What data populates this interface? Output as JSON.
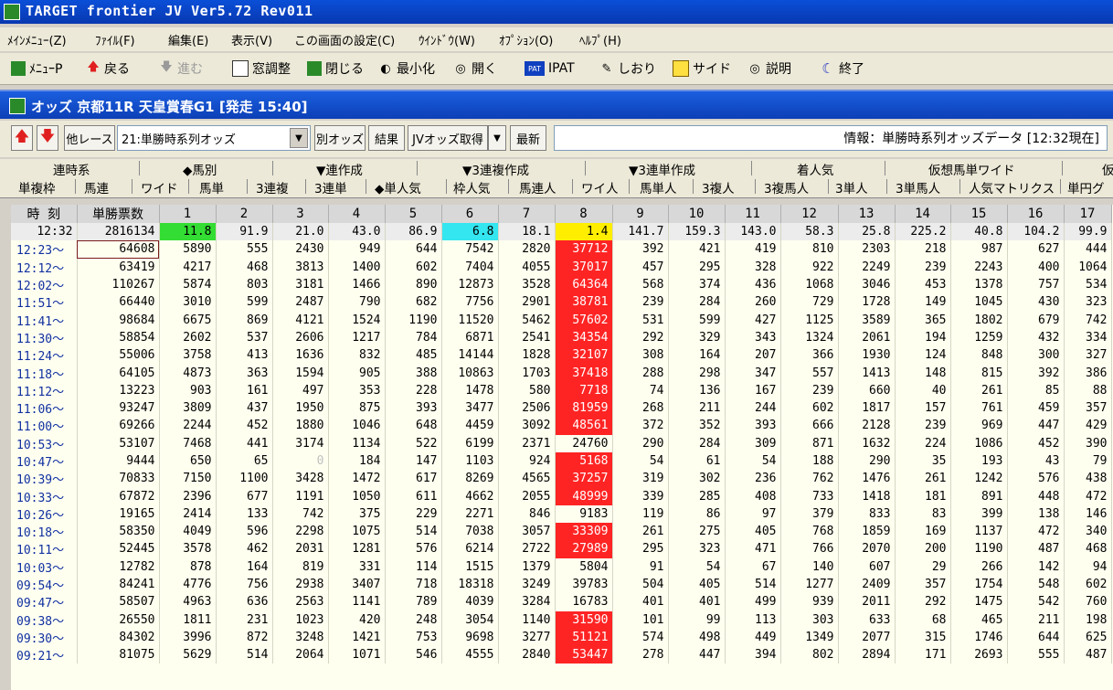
{
  "window": {
    "title": "TARGET frontier JV  Ver5.72  Rev011"
  },
  "menu": [
    "ﾒｲﾝﾒﾆｭｰ(Z)",
    "ﾌｧｲﾙ(F)",
    "編集(E)",
    "表示(V)",
    "この画面の設定(C)",
    "ｳｲﾝﾄﾞｳ(W)",
    "ｵﾌﾟｼｮﾝ(O)",
    "ﾍﾙﾌﾟ(H)"
  ],
  "toolbar": {
    "menu_p": "ﾒﾆｭｰP",
    "back": "戻る",
    "forward": "進む",
    "window_adjust": "窓調整",
    "close": "閉じる",
    "minimize": "最小化",
    "open": "開く",
    "ipat": "IPAT",
    "bookmark": "しおり",
    "side": "サイド",
    "help": "説明",
    "exit": "終了"
  },
  "subwindow": {
    "title": "オッズ 京都11R 天皇賞春G1  [発走 15:40]"
  },
  "controls": {
    "other_race": "他レース",
    "combo_value": "21:単勝時系列オッズ",
    "other_odds": "別オッズ",
    "result": "結果",
    "jv_odds": "JVオッズ取得",
    "dropdown_glyph": "▼",
    "refresh": "最新",
    "info": "情報：単勝時系列オッズデータ [12:32現在]"
  },
  "tabs_row1": [
    "連時系",
    "◆馬別",
    "▼連作成",
    "▼3連複作成",
    "▼3連単作成",
    "着人気",
    "仮想馬単ワイド",
    "仮"
  ],
  "tabs_row2": [
    "単複枠",
    "馬連",
    "ワイド",
    "馬単",
    "3連複",
    "3連単",
    "◆単人気",
    "枠人気",
    "馬連人",
    "ワイ人",
    "馬単人",
    "3複人",
    "3複馬人",
    "3単人",
    "3単馬人",
    "人気マトリクス",
    "単円グ"
  ],
  "table": {
    "headers": [
      "時 刻",
      "単勝票数",
      "1",
      "2",
      "3",
      "4",
      "5",
      "6",
      "7",
      "8",
      "9",
      "10",
      "11",
      "12",
      "13",
      "14",
      "15",
      "16",
      "17"
    ],
    "odds_row": [
      "12:32",
      "2816134",
      "11.8",
      "91.9",
      "21.0",
      "43.0",
      "86.9",
      "6.8",
      "18.1",
      "1.4",
      "141.7",
      "159.3",
      "143.0",
      "58.3",
      "25.8",
      "225.2",
      "40.8",
      "104.2",
      "99.9"
    ],
    "rows": [
      [
        "12:23～",
        "64608",
        "5890",
        "555",
        "2430",
        "949",
        "644",
        "7542",
        "2820",
        "37712",
        "392",
        "421",
        "419",
        "810",
        "2303",
        "218",
        "987",
        "627",
        "444"
      ],
      [
        "12:12～",
        "63419",
        "4217",
        "468",
        "3813",
        "1400",
        "602",
        "7404",
        "4055",
        "37017",
        "457",
        "295",
        "328",
        "922",
        "2249",
        "239",
        "2243",
        "400",
        "1064"
      ],
      [
        "12:02～",
        "110267",
        "5874",
        "803",
        "3181",
        "1466",
        "890",
        "12873",
        "3528",
        "64364",
        "568",
        "374",
        "436",
        "1068",
        "3046",
        "453",
        "1378",
        "757",
        "534"
      ],
      [
        "11:51～",
        "66440",
        "3010",
        "599",
        "2487",
        "790",
        "682",
        "7756",
        "2901",
        "38781",
        "239",
        "284",
        "260",
        "729",
        "1728",
        "149",
        "1045",
        "430",
        "323"
      ],
      [
        "11:41～",
        "98684",
        "6675",
        "869",
        "4121",
        "1524",
        "1190",
        "11520",
        "5462",
        "57602",
        "531",
        "599",
        "427",
        "1125",
        "3589",
        "365",
        "1802",
        "679",
        "742"
      ],
      [
        "11:30～",
        "58854",
        "2602",
        "537",
        "2606",
        "1217",
        "784",
        "6871",
        "2541",
        "34354",
        "292",
        "329",
        "343",
        "1324",
        "2061",
        "194",
        "1259",
        "432",
        "334"
      ],
      [
        "11:24～",
        "55006",
        "3758",
        "413",
        "1636",
        "832",
        "485",
        "14144",
        "1828",
        "32107",
        "308",
        "164",
        "207",
        "366",
        "1930",
        "124",
        "848",
        "300",
        "327"
      ],
      [
        "11:18～",
        "64105",
        "4873",
        "363",
        "1594",
        "905",
        "388",
        "10863",
        "1703",
        "37418",
        "288",
        "298",
        "347",
        "557",
        "1413",
        "148",
        "815",
        "392",
        "386"
      ],
      [
        "11:12～",
        "13223",
        "903",
        "161",
        "497",
        "353",
        "228",
        "1478",
        "580",
        "7718",
        "74",
        "136",
        "167",
        "239",
        "660",
        "40",
        "261",
        "85",
        "88"
      ],
      [
        "11:06～",
        "93247",
        "3809",
        "437",
        "1950",
        "875",
        "393",
        "3477",
        "2506",
        "81959",
        "268",
        "211",
        "244",
        "602",
        "1817",
        "157",
        "761",
        "459",
        "357"
      ],
      [
        "11:00～",
        "69266",
        "2244",
        "452",
        "1880",
        "1046",
        "648",
        "4459",
        "3092",
        "48561",
        "372",
        "352",
        "393",
        "666",
        "2128",
        "239",
        "969",
        "447",
        "429"
      ],
      [
        "10:53～",
        "53107",
        "7468",
        "441",
        "3174",
        "1134",
        "522",
        "6199",
        "2371",
        "24760",
        "290",
        "284",
        "309",
        "871",
        "1632",
        "224",
        "1086",
        "452",
        "390"
      ],
      [
        "10:47～",
        "9444",
        "650",
        "65",
        "0",
        "184",
        "147",
        "1103",
        "924",
        "5168",
        "54",
        "61",
        "54",
        "188",
        "290",
        "35",
        "193",
        "43",
        "79"
      ],
      [
        "10:39～",
        "70833",
        "7150",
        "1100",
        "3428",
        "1472",
        "617",
        "8269",
        "4565",
        "37257",
        "319",
        "302",
        "236",
        "762",
        "1476",
        "261",
        "1242",
        "576",
        "438"
      ],
      [
        "10:33～",
        "67872",
        "2396",
        "677",
        "1191",
        "1050",
        "611",
        "4662",
        "2055",
        "48999",
        "339",
        "285",
        "408",
        "733",
        "1418",
        "181",
        "891",
        "448",
        "472"
      ],
      [
        "10:26～",
        "19165",
        "2414",
        "133",
        "742",
        "375",
        "229",
        "2271",
        "846",
        "9183",
        "119",
        "86",
        "97",
        "379",
        "833",
        "83",
        "399",
        "138",
        "146"
      ],
      [
        "10:18～",
        "58350",
        "4049",
        "596",
        "2298",
        "1075",
        "514",
        "7038",
        "3057",
        "33309",
        "261",
        "275",
        "405",
        "768",
        "1859",
        "169",
        "1137",
        "472",
        "340"
      ],
      [
        "10:11～",
        "52445",
        "3578",
        "462",
        "2031",
        "1281",
        "576",
        "6214",
        "2722",
        "27989",
        "295",
        "323",
        "471",
        "766",
        "2070",
        "200",
        "1190",
        "487",
        "468"
      ],
      [
        "10:03～",
        "12782",
        "878",
        "164",
        "819",
        "331",
        "114",
        "1515",
        "1379",
        "5804",
        "91",
        "54",
        "67",
        "140",
        "607",
        "29",
        "266",
        "142",
        "94"
      ],
      [
        "09:54～",
        "84241",
        "4776",
        "756",
        "2938",
        "3407",
        "718",
        "18318",
        "3249",
        "39783",
        "504",
        "405",
        "514",
        "1277",
        "2409",
        "357",
        "1754",
        "548",
        "602"
      ],
      [
        "09:47～",
        "58507",
        "4963",
        "636",
        "2563",
        "1141",
        "789",
        "4039",
        "3284",
        "16783",
        "401",
        "401",
        "499",
        "939",
        "2011",
        "292",
        "1475",
        "542",
        "760"
      ],
      [
        "09:38～",
        "26550",
        "1811",
        "231",
        "1023",
        "420",
        "248",
        "3054",
        "1140",
        "31590",
        "101",
        "99",
        "113",
        "303",
        "633",
        "68",
        "465",
        "211",
        "198"
      ],
      [
        "09:30～",
        "84302",
        "3996",
        "872",
        "3248",
        "1421",
        "753",
        "9698",
        "3277",
        "51121",
        "574",
        "498",
        "449",
        "1349",
        "2077",
        "315",
        "1746",
        "644",
        "625"
      ],
      [
        "09:21～",
        "81075",
        "5629",
        "514",
        "2064",
        "1071",
        "546",
        "4555",
        "2840",
        "53447",
        "278",
        "447",
        "394",
        "802",
        "2894",
        "171",
        "2693",
        "555",
        "487"
      ]
    ],
    "red_rows": [
      0,
      1,
      2,
      3,
      4,
      5,
      6,
      7,
      8,
      9,
      10,
      12,
      13,
      14,
      16,
      17,
      21,
      22,
      23
    ]
  }
}
